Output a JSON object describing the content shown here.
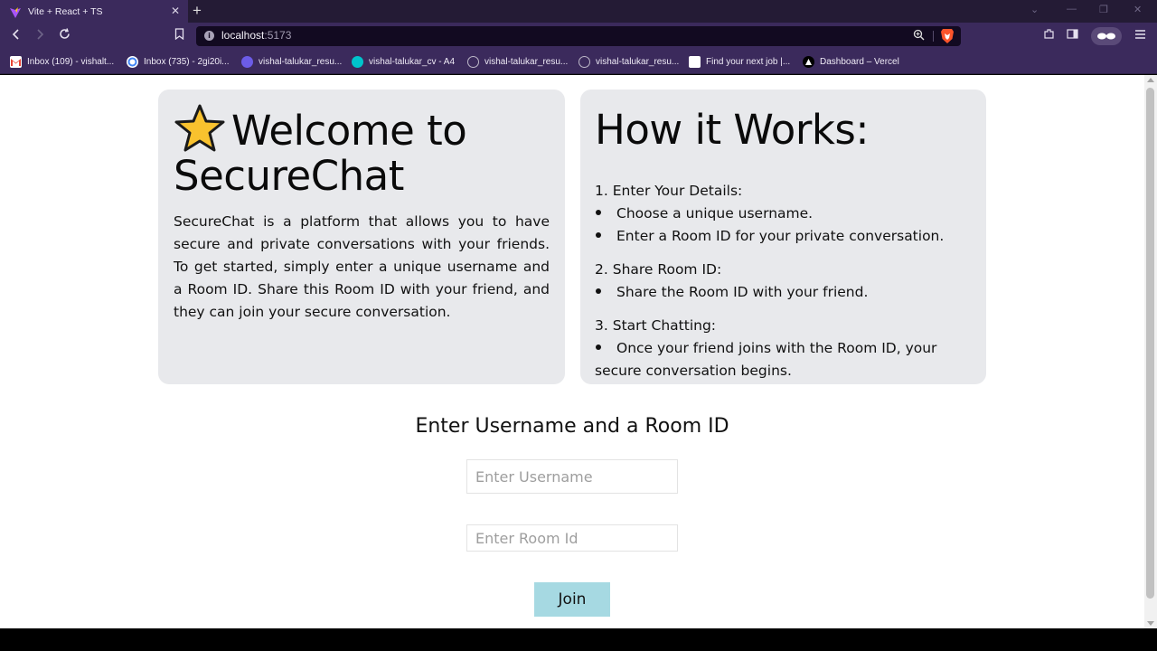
{
  "browser": {
    "tab_title": "Vite + React + TS",
    "tab_close": "✕",
    "new_tab": "+",
    "url_host": "localhost",
    "url_port": ":5173",
    "window_controls": [
      "—",
      "❐",
      "✕"
    ],
    "bookmarks": [
      {
        "label": "Inbox (109) - vishalt...",
        "icon": "gmail-icon",
        "color": "#ea4335"
      },
      {
        "label": "Inbox (735) - 2gi20i...",
        "icon": "google-icon",
        "color": "#ffffff"
      },
      {
        "label": "vishal-talukar_resu...",
        "icon": "docs-icon",
        "color": "#6c5ce7"
      },
      {
        "label": "vishal-talukar_cv - A4",
        "icon": "canva-icon",
        "color": "#00c4cc"
      },
      {
        "label": "vishal-talukar_resu...",
        "icon": "globe-icon",
        "color": "#bdb8c8"
      },
      {
        "label": "vishal-talukar_resu...",
        "icon": "globe-icon",
        "color": "#bdb8c8"
      },
      {
        "label": "Find your next job |...",
        "icon": "job-icon",
        "color": "#ffffff"
      },
      {
        "label": "Dashboard – Vercel",
        "icon": "vercel-icon",
        "color": "#000000"
      }
    ]
  },
  "welcome": {
    "title": "Welcome to SecureChat",
    "intro": "SecureChat is a platform that allows you to have secure and private conversations with your friends. To get started, simply enter a unique username and a Room ID. Share this Room ID with your friend, and they can join your secure conversation."
  },
  "how": {
    "title": "How it Works:",
    "steps": [
      {
        "num": "1.",
        "title": "Enter Your Details:",
        "items": [
          "Choose a unique username.",
          "Enter a Room ID for your private conversation."
        ]
      },
      {
        "num": "2.",
        "title": "Share Room ID:",
        "items": [
          "Share the Room ID with your friend."
        ]
      },
      {
        "num": "3.",
        "title": "Start Chatting:",
        "items": [
          "Once your friend joins with the Room ID, your secure conversation begins."
        ]
      }
    ]
  },
  "form": {
    "heading": "Enter Username and a Room ID",
    "username_placeholder": "Enter Username",
    "room_placeholder": "Enter Room Id",
    "join_label": "Join"
  },
  "colors": {
    "card_bg": "#e8e9ec",
    "join_bg": "#a6d9e2",
    "chrome_bg": "#3b2a5c"
  }
}
